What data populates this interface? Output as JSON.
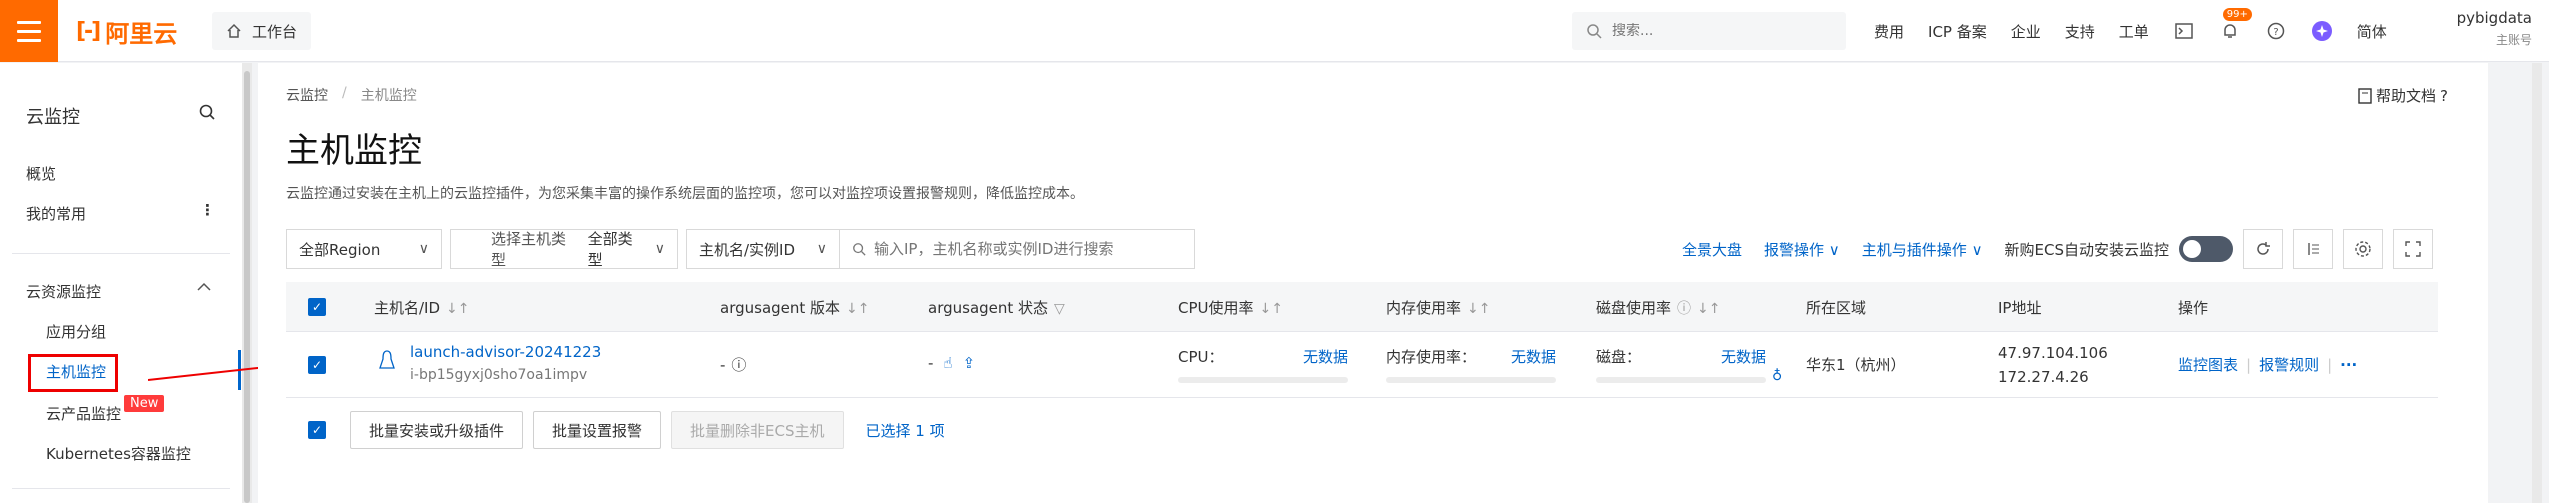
{
  "topbar": {
    "logo_text": "阿里云",
    "workbench": "工作台",
    "search_placeholder": "搜索...",
    "links": [
      "费用",
      "ICP 备案",
      "企业",
      "支持",
      "工单"
    ],
    "notification_badge": "99+",
    "language": "简体",
    "user_name": "pybigdata",
    "user_role": "主账号"
  },
  "sidebar": {
    "title": "云监控",
    "overview": "概览",
    "favorites": "我的常用",
    "section_label": "云资源监控",
    "items": [
      "应用分组",
      "主机监控",
      "云产品监控",
      "Kubernetes容器监控"
    ],
    "new_badge": "New"
  },
  "main": {
    "breadcrumb": [
      "云监控",
      "主机监控"
    ],
    "breadcrumb_sep": "/",
    "help_doc": "帮助文档",
    "title": "主机监控",
    "description": "云监控通过安装在主机上的云监控插件，为您采集丰富的操作系统层面的监控项，您可以对监控项设置报警规则，降低监控成本。",
    "filters": {
      "region": "全部Region",
      "host_type_label": "选择主机类型",
      "host_type": "全部类型",
      "name_filter": "主机名/实例ID",
      "search_placeholder": "输入IP，主机名称或实例ID进行搜索"
    },
    "actions": {
      "dashboard": "全景大盘",
      "alarm_ops": "报警操作",
      "host_plugin_ops": "主机与插件操作",
      "auto_install_label": "新购ECS自动安装云监控"
    },
    "table": {
      "headers": [
        "主机名/ID",
        "argusagent 版本",
        "argusagent 状态",
        "CPU使用率",
        "内存使用率",
        "磁盘使用率",
        "所在区域",
        "IP地址",
        "操作"
      ],
      "rows": [
        {
          "host_name": "launch-advisor-20241223",
          "host_id": "i-bp15gyxj0sho7oa1impv",
          "agent_version": "-",
          "agent_status": "-",
          "cpu_label": "CPU：",
          "cpu_value": "无数据",
          "mem_label": "内存使用率：",
          "mem_value": "无数据",
          "disk_label": "磁盘：",
          "disk_value": "无数据",
          "region": "华东1（杭州）",
          "ip_public": "47.97.104.106",
          "ip_private": "172.27.4.26",
          "op_monitor": "监控图表",
          "op_alarm": "报警规则",
          "op_more": "···"
        }
      ]
    },
    "footer": {
      "batch_install": "批量安装或升级插件",
      "batch_alarm": "批量设置报警",
      "batch_delete": "批量删除非ECS主机",
      "selected": "已选择 1 项"
    }
  },
  "colors": {
    "brand_orange": "#ff6a00",
    "link_blue": "#0064c8",
    "highlight_red": "#e00000"
  }
}
